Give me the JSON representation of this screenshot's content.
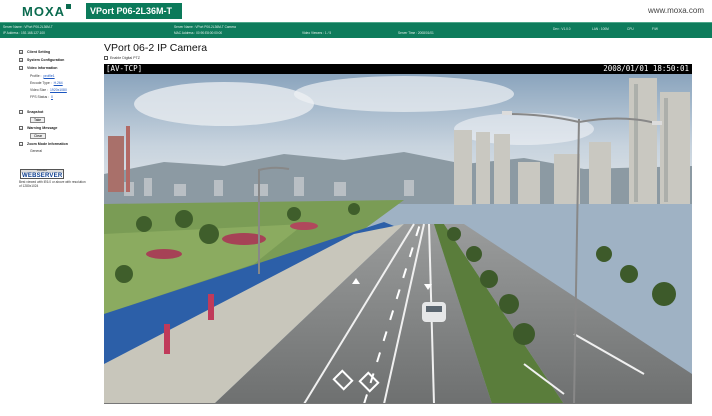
{
  "header": {
    "brand": "MOXA",
    "model": "VPort P06-2L36M-T",
    "site_link": "www.moxa.com"
  },
  "infobar": {
    "cells": [
      "Server Name : VPort P06-2L36M-T",
      "IP Address : 192.168.127.100",
      "Server Name : VPort P06-2L36M-T Camera",
      "MAC Address : 00:90:E8:00:00:00",
      "Video Viewers : 1 / 5",
      "Server Time : 2008/01/01",
      "Dev : V1.0.0",
      "LAN : 100M",
      "CPU",
      "F/W"
    ]
  },
  "sidebar": {
    "client_setting": "Client Setting",
    "system_configuration": "System Configuration",
    "video_information": "Video Information",
    "profile_label": "Profile :",
    "profile_value": "profile1",
    "encode_type_label": "Encode Type :",
    "encode_type_value": "H.264",
    "video_size_label": "Video Size :",
    "video_size_value": "1920x1080",
    "fps_status_label": "FPS Status :",
    "fps_status_value": "0",
    "snapshot": "Snapshot",
    "take_button": "Take",
    "warning_message": "Warning Message",
    "clear_button": "Clear",
    "zoom_mode_information": "Zoom Mode Information",
    "zoom_mode_value": "General",
    "webserver_logo_top": "Embedded",
    "webserver_logo_word": "WEBSERVER",
    "webserver_note": "Best viewed with IE6.0 or above with resolution of 1280x1024"
  },
  "main": {
    "title": "VPort 06-2 IP Camera",
    "enable_option_label": "Enable Digital PTZ",
    "video_header_left": "[AV-TCP]",
    "video_header_right": "2008/01/01 18:50:01"
  }
}
